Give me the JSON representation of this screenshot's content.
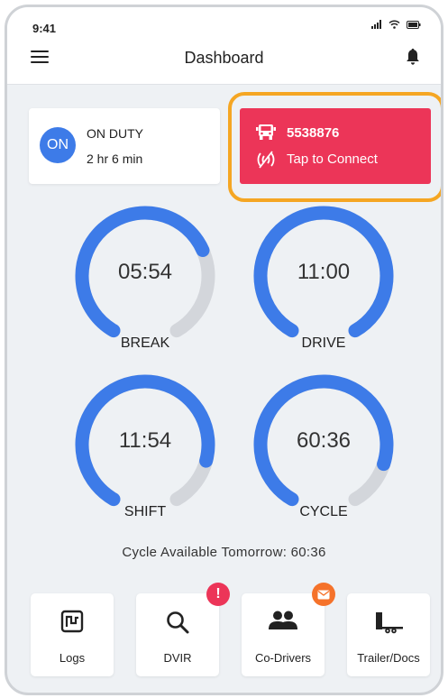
{
  "status_bar": {
    "time": "9:41"
  },
  "header": {
    "title": "Dashboard"
  },
  "duty_status": {
    "badge": "ON",
    "label": "ON DUTY",
    "elapsed": "2 hr 6 min"
  },
  "vehicle": {
    "number": "5538876",
    "connect_label": "Tap to Connect",
    "status_color": "#ec3558",
    "highlight_color": "#f5a623"
  },
  "gauges": [
    {
      "id": "break",
      "value": "05:54",
      "label": "BREAK",
      "fraction": 0.72
    },
    {
      "id": "drive",
      "value": "11:00",
      "label": "DRIVE",
      "fraction": 1.0
    },
    {
      "id": "shift",
      "value": "11:54",
      "label": "SHIFT",
      "fraction": 0.85
    },
    {
      "id": "cycle",
      "value": "60:36",
      "label": "CYCLE",
      "fraction": 0.86
    }
  ],
  "gauge_colors": {
    "progress": "#3d7be8",
    "track": "#d3d6db"
  },
  "cycle_tomorrow": "Cycle Available Tomorrow: 60:36",
  "tiles": [
    {
      "label": "Logs",
      "icon": "logs-icon"
    },
    {
      "label": "DVIR",
      "icon": "search-icon",
      "badge": "!",
      "badge_color": "#ec3558"
    },
    {
      "label": "Co-Drivers",
      "icon": "group-icon",
      "badge_icon": "mail-icon",
      "badge_color": "#f5722a"
    },
    {
      "label": "Trailer/Docs",
      "icon": "trailer-icon"
    }
  ]
}
